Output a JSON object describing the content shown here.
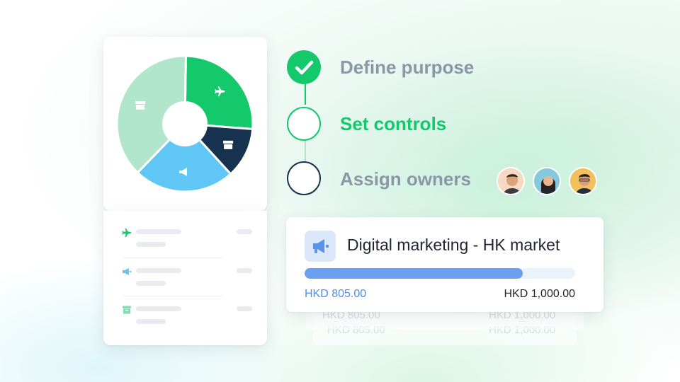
{
  "theme": {
    "green": "#14c96b",
    "light_green": "#b1e6cc",
    "navy": "#16324f",
    "sky_blue": "#5fc6f5",
    "muted_text": "#8a97a6",
    "progress_blue": "#6b9ff0"
  },
  "pie": {
    "segments": [
      {
        "name": "travel",
        "color": "#14c96b",
        "icon": "plane-icon",
        "fraction": 0.26
      },
      {
        "name": "storage-dark",
        "color": "#16324f",
        "icon": "archive-icon",
        "fraction": 0.12
      },
      {
        "name": "marketing",
        "color": "#5fc6f5",
        "icon": "megaphone-icon",
        "fraction": 0.24
      },
      {
        "name": "storage-light",
        "color": "#b1e6cc",
        "icon": "archive-icon",
        "fraction": 0.38
      }
    ]
  },
  "category_list": [
    {
      "icon": "plane-icon",
      "color": "#14c96b"
    },
    {
      "icon": "megaphone-icon",
      "color": "#5fc6f5"
    },
    {
      "icon": "archive-icon",
      "color": "#7fe0ae"
    }
  ],
  "steps": [
    {
      "label": "Define purpose",
      "state": "done"
    },
    {
      "label": "Set controls",
      "state": "active"
    },
    {
      "label": "Assign owners",
      "state": "pending"
    }
  ],
  "owners": [
    {
      "name": "owner-1"
    },
    {
      "name": "owner-2"
    },
    {
      "name": "owner-3"
    }
  ],
  "budget_card": {
    "icon": "megaphone-icon",
    "title": "Digital marketing - HK market",
    "spent": "HKD 805.00",
    "total": "HKD 1,000.00",
    "progress": 0.805
  },
  "ghost_cards": [
    {
      "spent": "HKD 805.00",
      "total": "HKD 1,000.00"
    },
    {
      "spent": "HKD 805.00",
      "total": "HKD 1,000.00"
    }
  ]
}
